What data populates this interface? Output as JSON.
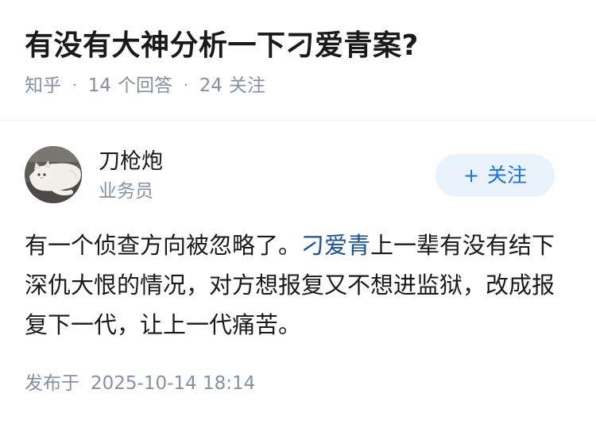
{
  "question": {
    "title": "有没有大神分析一下刁爱青案?",
    "source": "知乎",
    "answer_count": "14",
    "answer_label": "个回答",
    "follower_count": "24",
    "follower_label": "关注"
  },
  "author": {
    "name": "刀枪炮",
    "headline": "业务员",
    "avatar_icon": "avatar-cat-photo"
  },
  "follow_button": {
    "plus": "+",
    "label": "关注"
  },
  "answer": {
    "text_before": "有一个侦查方向被忽略了。",
    "link_text": "刁爱青",
    "text_after": "上一辈有没有结下深仇大恨的情况，对方想报复又不想进监狱，改成报复下一代，让上一代痛苦。"
  },
  "publish": {
    "label": "发布于",
    "time": "2025-10-14 18:14"
  },
  "colors": {
    "text": "#1a1a1a",
    "meta": "#8590a6",
    "link": "#175199",
    "follow_bg": "#eaf2fc",
    "follow_text": "#1772f6"
  }
}
